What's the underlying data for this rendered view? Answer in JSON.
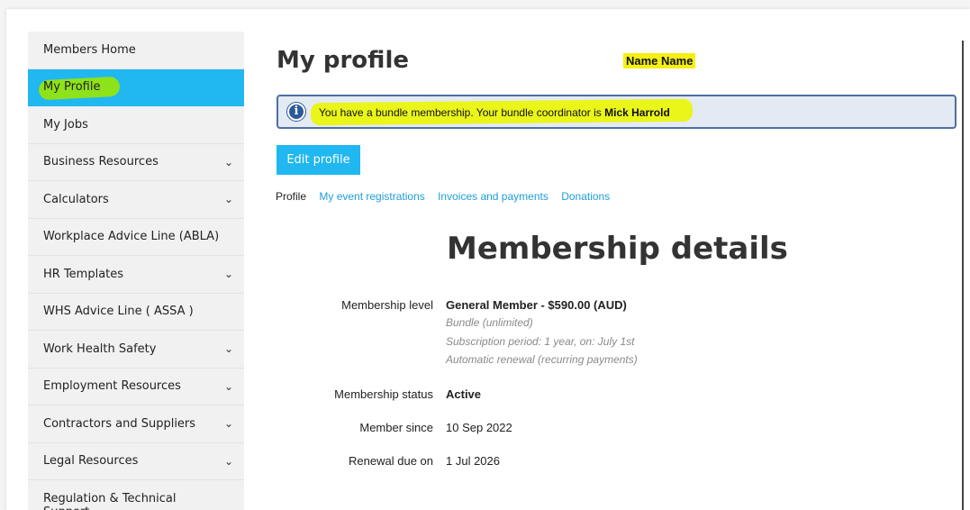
{
  "sidebar": {
    "items": [
      {
        "label": "Members Home",
        "has_chevron": false
      },
      {
        "label": "My Profile",
        "has_chevron": false,
        "active": true
      },
      {
        "label": "My Jobs",
        "has_chevron": false
      },
      {
        "label": "Business Resources",
        "has_chevron": true
      },
      {
        "label": "Calculators",
        "has_chevron": true
      },
      {
        "label": "Workplace Advice Line (ABLA)",
        "has_chevron": false
      },
      {
        "label": "HR Templates",
        "has_chevron": true
      },
      {
        "label": "WHS Advice Line ( ASSA )",
        "has_chevron": false
      },
      {
        "label": "Work Health Safety",
        "has_chevron": true
      },
      {
        "label": "Employment Resources",
        "has_chevron": true
      },
      {
        "label": "Contractors and Suppliers",
        "has_chevron": true
      },
      {
        "label": "Legal Resources",
        "has_chevron": true
      },
      {
        "label": "Regulation & Technical Support",
        "has_chevron": true
      }
    ],
    "chevron_icon": "chevron-down-icon"
  },
  "header": {
    "title": "My profile",
    "user_name": "Name Name"
  },
  "banner": {
    "icon": "info-icon",
    "text": "You have a bundle membership. Your bundle coordinator is ",
    "coordinator": "Mick Harrold"
  },
  "actions": {
    "edit_label": "Edit profile"
  },
  "tabs": {
    "current": "Profile",
    "links": [
      "My event registrations",
      "Invoices and payments",
      "Donations"
    ]
  },
  "membership": {
    "section_title": "Membership details",
    "level_label": "Membership level",
    "level_value": "General Member - $590.00 (AUD)",
    "level_notes": [
      "Bundle (unlimited)",
      "Subscription period: 1 year, on: July 1st",
      "Automatic renewal (recurring payments)"
    ],
    "status_label": "Membership status",
    "status_value": "Active",
    "since_label": "Member since",
    "since_value": "10 Sep 2022",
    "renewal_label": "Renewal due on",
    "renewal_value": "1 Jul 2026"
  },
  "colors": {
    "accent": "#21b7f0",
    "link": "#1e9fd8",
    "banner_bg": "#e4eaf3",
    "banner_border": "#4e6fa3",
    "highlight_green": "#8ee21a",
    "highlight_yellow": "#eaf51a"
  }
}
